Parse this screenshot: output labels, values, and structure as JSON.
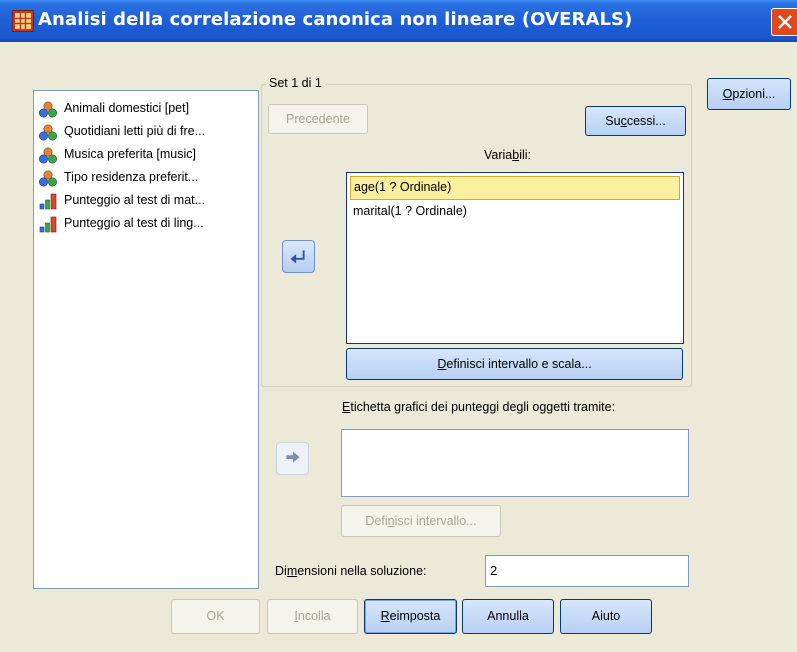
{
  "window": {
    "title": "Analisi della correlazione canonica non lineare (OVERALS)",
    "close_label": "✕"
  },
  "source_list": {
    "items": [
      {
        "label": "Animali domestici [pet]",
        "icon": "nominal-variable-icon"
      },
      {
        "label": "Quotidiani letti più di fre...",
        "icon": "nominal-variable-icon"
      },
      {
        "label": "Musica preferita [music]",
        "icon": "nominal-variable-icon"
      },
      {
        "label": "Tipo residenza preferit...",
        "icon": "nominal-variable-icon"
      },
      {
        "label": "Punteggio al test di mat...",
        "icon": "scale-variable-icon"
      },
      {
        "label": "Punteggio al test di ling...",
        "icon": "scale-variable-icon"
      }
    ]
  },
  "set_group": {
    "legend": "Set 1 di 1",
    "prev_button": "Precedente",
    "next_button_pre": "Su",
    "next_button_ul": "c",
    "next_button_post": "cessi...",
    "variables_label_pre": "Varia",
    "variables_label_ul": "b",
    "variables_label_post": "ili:",
    "variables": [
      {
        "label": "age(1 ? Ordinale)",
        "selected": true
      },
      {
        "label": "marital(1 ? Ordinale)",
        "selected": false
      }
    ],
    "define_range_scale_pre": "",
    "define_range_scale_ul": "D",
    "define_range_scale_post": "efinisci intervallo e scala..."
  },
  "label_section": {
    "label_pre": "",
    "label_ul": "E",
    "label_post": "tichetta grafici dei punteggi degli oggetti tramite:",
    "field_value": "",
    "define_range_pre": "Defi",
    "define_range_ul": "n",
    "define_range_post": "isci intervallo..."
  },
  "dimensions": {
    "label_pre": "Di",
    "label_ul": "m",
    "label_post": "ensioni nella soluzione:",
    "value": "2"
  },
  "side_buttons": {
    "options_pre": "",
    "options_ul": "O",
    "options_post": "pzioni..."
  },
  "footer": {
    "ok": "OK",
    "paste_pre": "",
    "paste_ul": "I",
    "paste_post": "ncolla",
    "reset_pre": "",
    "reset_ul": "R",
    "reset_post": "eimposta",
    "cancel": "Annulla",
    "help": "Aiuto"
  },
  "colors": {
    "titlebar": "#1E5FD8",
    "dialog_bg": "#ECE9D8",
    "selected_row": "#FBEFA0",
    "button_border": "#003C74"
  }
}
